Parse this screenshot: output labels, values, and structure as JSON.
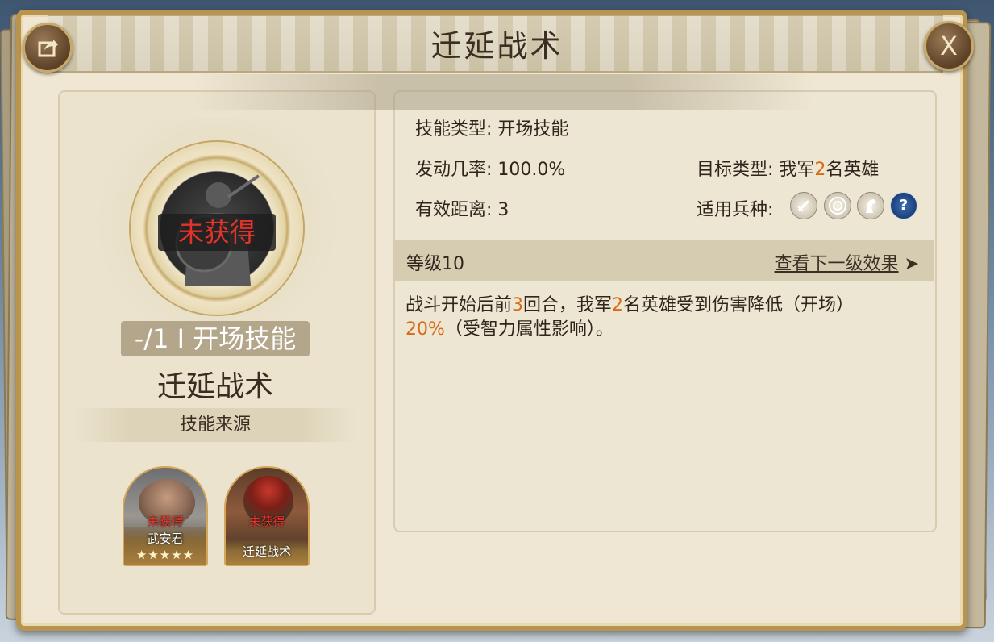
{
  "window": {
    "title": "迁延战术",
    "share_icon": "share-icon",
    "close_label": "X"
  },
  "skill_card": {
    "status_badge": "未获得",
    "level_chip": "-/1 I 开场技能",
    "name": "迁延战术",
    "source_header": "技能来源"
  },
  "sources": [
    {
      "status": "未获得",
      "name": "武安君",
      "stars": "★★★★★",
      "star_count": 5
    },
    {
      "status": "未获得",
      "name": "迁延战术"
    }
  ],
  "info": {
    "skill_type": "技能类型: 开场技能",
    "trigger_rate": "发动几率: 100.0%",
    "range": "有效距离: 3",
    "target_label": "目标类型: ",
    "target_pre": "我军",
    "target_num": "2",
    "target_post": "名英雄",
    "troop_label": "适用兵种:",
    "troop_icons": [
      "sword-icon",
      "target-icon",
      "horse-icon",
      "question-icon"
    ],
    "help_glyph": "?"
  },
  "level": {
    "label": "等级10",
    "next_link": "查看下一级效果",
    "arrow": "➤"
  },
  "description": {
    "p1": "战斗开始后前",
    "n1": "3",
    "p2": "回合，我军",
    "n2": "2",
    "p3": "名英雄受到伤害降低（开场）",
    "n3": "20%",
    "p4": "（受智力属性影响）。"
  },
  "colors": {
    "highlight": "#d86a16",
    "unobtained": "#e5332a",
    "frame_gold": "#b9944f"
  }
}
